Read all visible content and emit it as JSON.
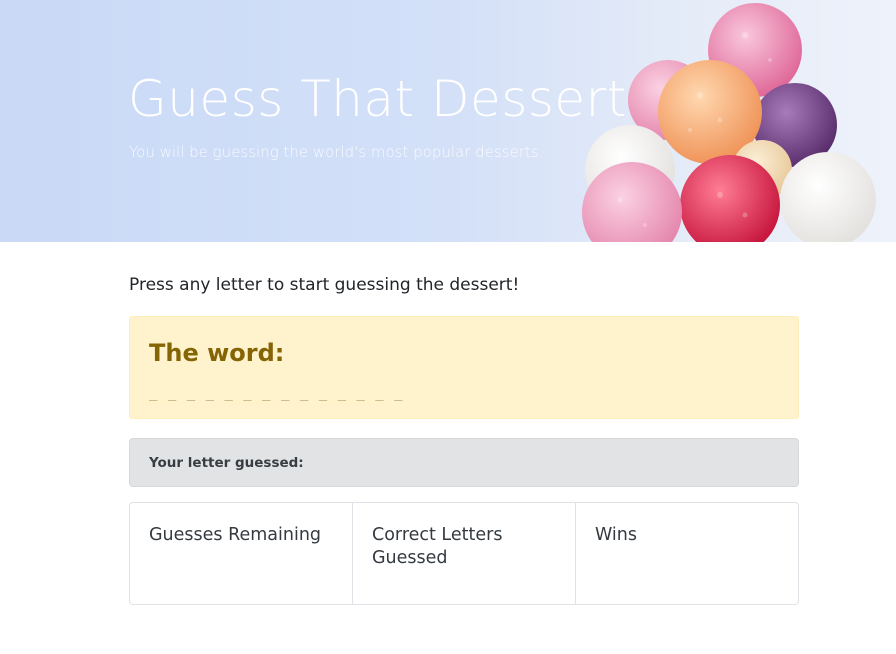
{
  "hero": {
    "title": "Guess That Dessert!",
    "subtitle": "You will be guessing the world's most popular desserts.",
    "image": "ice-cream-scoops"
  },
  "prompt": "Press any letter to start guessing the dessert!",
  "word": {
    "title": "The word:",
    "blanks": "_ _ _ _ _ _ _ _ _ _ _ _ _ _"
  },
  "guessed": {
    "label": "Your letter guessed:",
    "letters": ""
  },
  "stats": [
    {
      "title": "Guesses Remaining",
      "value": ""
    },
    {
      "title": "Correct Letters Guessed",
      "value": ""
    },
    {
      "title": "Wins",
      "value": ""
    }
  ],
  "colors": {
    "hero_bg": "#d3e0f8",
    "word_bg": "#fff3cd",
    "word_text": "#856404",
    "guess_bg": "#e2e3e5"
  }
}
